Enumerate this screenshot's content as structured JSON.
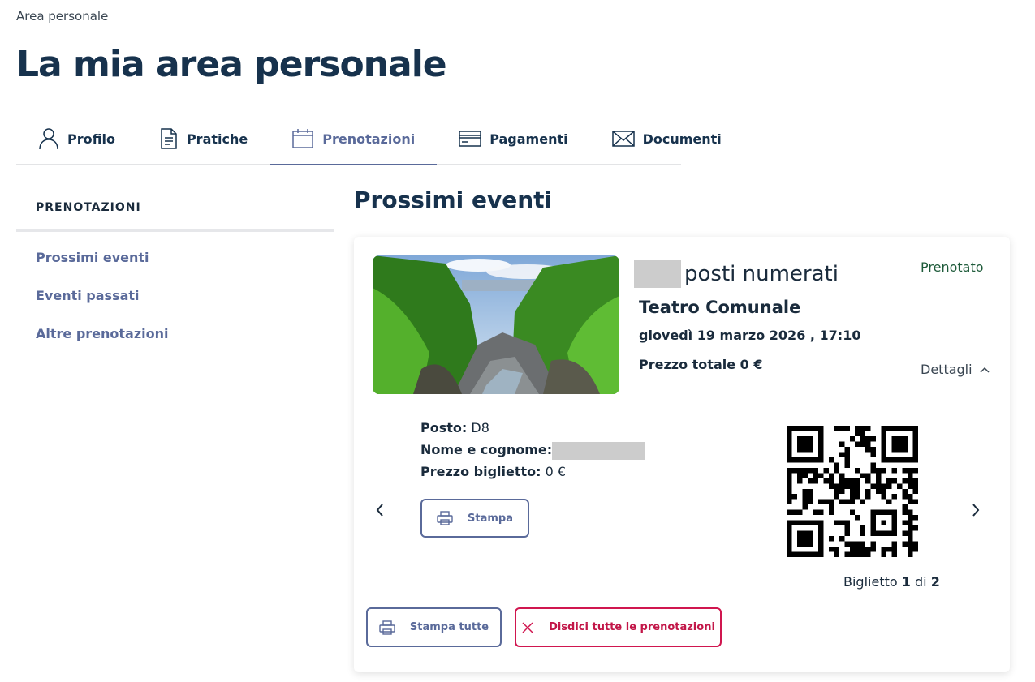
{
  "breadcrumb": "Area personale",
  "page_title": "La mia area personale",
  "tabs": [
    {
      "label": "Profilo",
      "icon": "user-icon"
    },
    {
      "label": "Pratiche",
      "icon": "document-icon"
    },
    {
      "label": "Prenotazioni",
      "icon": "calendar-icon",
      "active": true
    },
    {
      "label": "Pagamenti",
      "icon": "credit-card-icon"
    },
    {
      "label": "Documenti",
      "icon": "envelope-icon"
    }
  ],
  "sidebar": {
    "title": "PRENOTAZIONI",
    "items": [
      {
        "label": "Prossimi eventi"
      },
      {
        "label": "Eventi passati"
      },
      {
        "label": "Altre prenotazioni"
      }
    ]
  },
  "main": {
    "title": "Prossimi eventi",
    "event": {
      "name": "posti numerati",
      "status": "Prenotato",
      "venue": "Teatro Comunale",
      "datetime": "giovedì 19 marzo 2026 , 17:10",
      "total_price": "Prezzo totale 0 €",
      "details_label": "Dettagli",
      "ticket": {
        "seat_label": "Posto:",
        "seat_value": "D8",
        "name_label": "Nome e cognome:",
        "price_label": "Prezzo biglietto:",
        "price_value": "0 €",
        "print_label": "Stampa"
      },
      "ticket_counter": {
        "prefix": "Biglietto",
        "current": "1",
        "separator": "di",
        "total": "2"
      },
      "print_all_label": "Stampa tutte",
      "cancel_all_label": "Disdici tutte le prenotazioni"
    }
  },
  "colors": {
    "primary": "#5a6a9a",
    "heading": "#17324d",
    "status": "#1e5b3a",
    "danger": "#d0164f"
  }
}
